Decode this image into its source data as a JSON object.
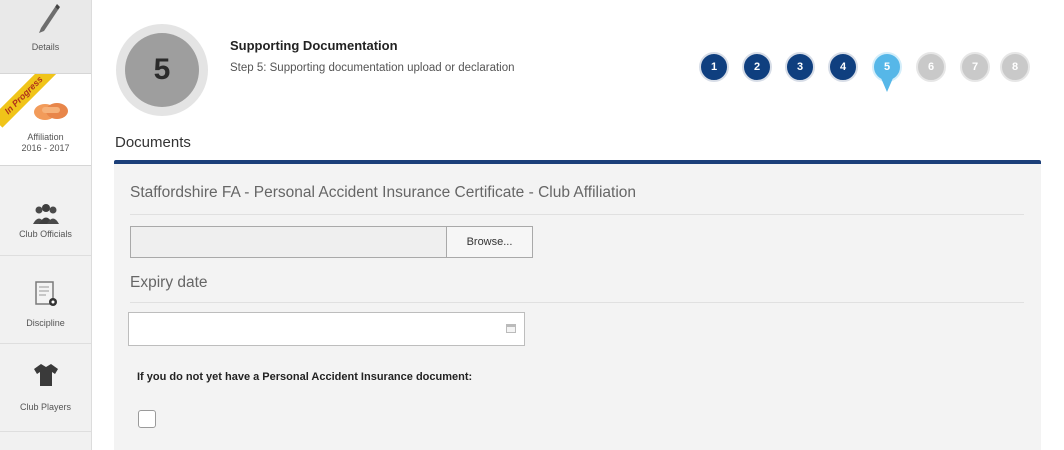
{
  "sidebar": {
    "details_label": "Details",
    "ribbon_text": "In Progress",
    "affiliation_label": "Affiliation",
    "affiliation_season": "2016 - 2017",
    "club_officials_label": "Club Officials",
    "discipline_label": "Discipline",
    "club_players_label": "Club Players"
  },
  "header": {
    "step_number": "5",
    "title": "Supporting Documentation",
    "description": "Step 5: Supporting documentation upload or declaration"
  },
  "steps": [
    {
      "num": "1",
      "state": "done"
    },
    {
      "num": "2",
      "state": "done"
    },
    {
      "num": "3",
      "state": "done"
    },
    {
      "num": "4",
      "state": "done"
    },
    {
      "num": "5",
      "state": "current"
    },
    {
      "num": "6",
      "state": "todo"
    },
    {
      "num": "7",
      "state": "todo"
    },
    {
      "num": "8",
      "state": "todo"
    }
  ],
  "colors": {
    "step_done": "#0f3f7f",
    "step_current": "#56b7e8",
    "step_todo": "#c9c9c9",
    "accent_bar": "#1b3f79"
  },
  "documents": {
    "section_title": "Documents",
    "certificate_title": "Staffordshire FA - Personal Accident Insurance Certificate - Club Affiliation",
    "file_value": "",
    "browse_label": "Browse...",
    "expiry_label": "Expiry date",
    "expiry_value": "",
    "note": "If you do not yet have a Personal Accident Insurance document:",
    "checkbox_checked": false
  },
  "icons": {
    "details": "pencil-icon",
    "affiliation": "handshake-icon",
    "club_officials": "people-icon",
    "discipline": "card-ball-icon",
    "club_players": "shirt-icon",
    "expiry": "calendar-icon"
  }
}
